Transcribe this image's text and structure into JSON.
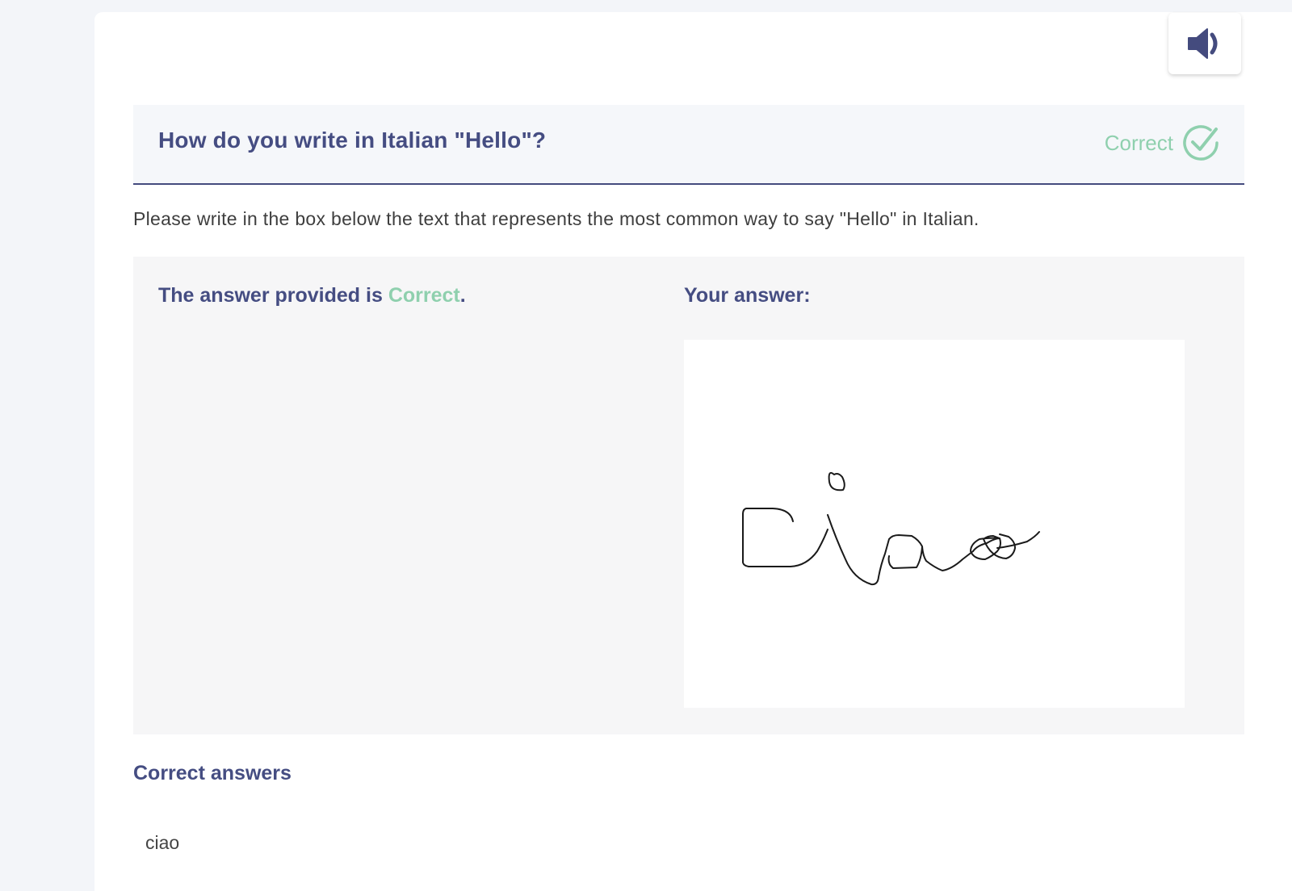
{
  "audio_button": {
    "icon": "speaker-icon"
  },
  "question": {
    "title": "How do you write in Italian \"Hello\"?",
    "status_label": "Correct",
    "status_icon": "check-circle-icon"
  },
  "instructions": "Please write in the box below the text that represents the most common way to say \"Hello\" in Italian.",
  "result": {
    "prefix": "The answer provided is ",
    "value": "Correct",
    "suffix": "."
  },
  "your_answer": {
    "label": "Your answer:",
    "handwritten_text": "ciao"
  },
  "correct_answers": {
    "heading": "Correct answers",
    "values": [
      "ciao"
    ]
  },
  "colors": {
    "accent": "#454d82",
    "correct": "#8fd0ae",
    "background": "#f3f5f9"
  }
}
